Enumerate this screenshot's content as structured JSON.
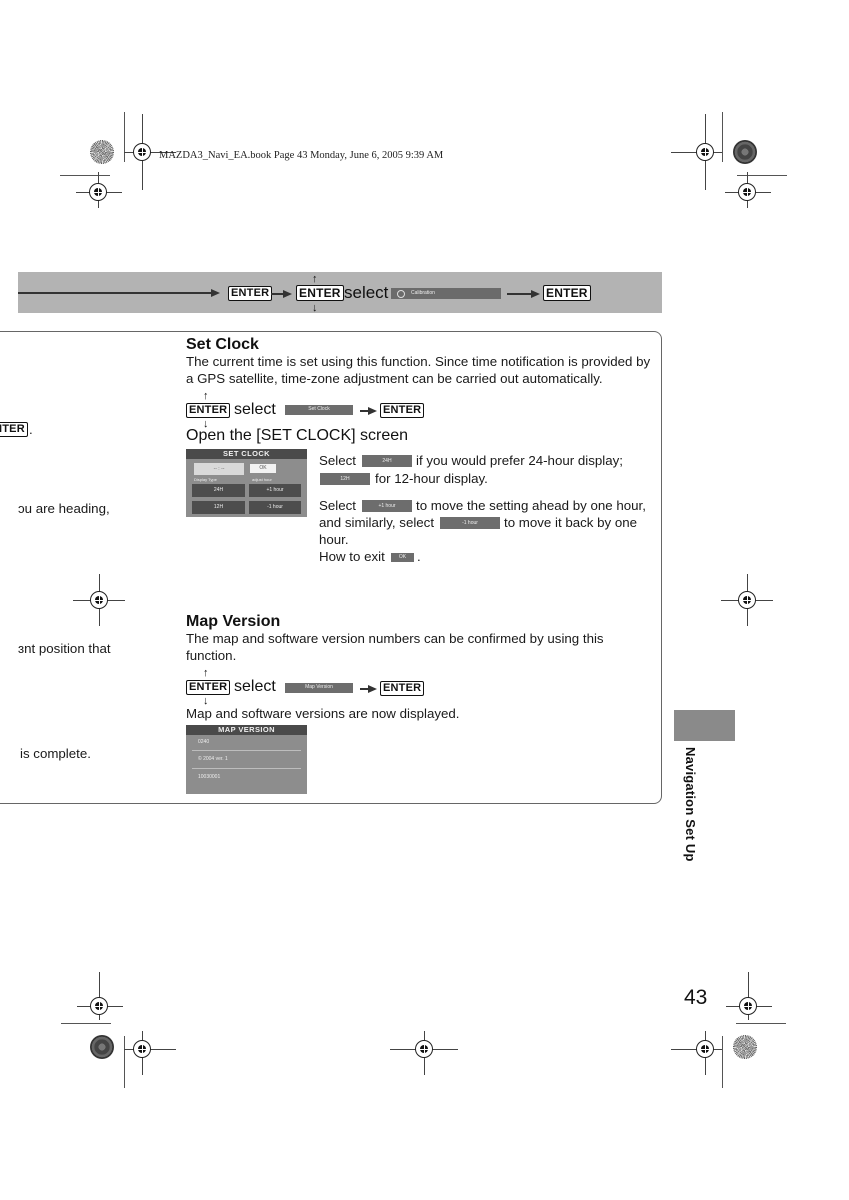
{
  "print_header": "MAZDA3_Navi_EA.book  Page 43  Monday, June 6, 2005  9:39 AM",
  "banner": {
    "enter_1": "ENTER",
    "enter_2": "ENTER",
    "select_word": "select",
    "menu_item": "Calibration",
    "enter_3": "ENTER"
  },
  "left_fragments": {
    "enter_partial": "ITER",
    "enter_period": ".",
    "line_1": "ɔu are heading,",
    "line_2": "ɜnt position that",
    "line_3": "is complete."
  },
  "set_clock": {
    "heading": "Set Clock",
    "description_line1": "The current time is set using this function. Since time notification is provided by",
    "description_line2": "a GPS satellite, time-zone adjustment can be carried out automatically.",
    "enter_1": "ENTER",
    "select_word": "select",
    "menu_item": "Set Clock",
    "enter_2": "ENTER",
    "open_screen": "Open the [SET CLOCK] screen",
    "screen": {
      "title": "SET CLOCK",
      "time_field": "-- : --",
      "ok": "OK",
      "display_type_label": "Display Type",
      "adjust_hour_label": "adjust hour",
      "btn_24h": "24H",
      "btn_12h": "12H",
      "btn_plus": "+1 hour",
      "btn_minus": "-1 hour"
    },
    "instr": {
      "select_1": "Select",
      "chip_24h": "24H",
      "text_24h": "if you would prefer 24-hour display;",
      "chip_12h": "12H",
      "text_12h": "for 12-hour display.",
      "select_2": "Select",
      "chip_plus": "+1 hour",
      "text_plus": "to move the setting ahead by one hour,",
      "text_similarly": "and similarly, select",
      "chip_minus": "-1 hour",
      "text_minus": "to move it back by one",
      "text_hour": "hour.",
      "text_exit": "How to exit",
      "chip_ok": "OK",
      "text_period": "."
    }
  },
  "map_version": {
    "heading": "Map Version",
    "description_line1": "The map and software version numbers can be confirmed by using this",
    "description_line2": "function.",
    "enter_1": "ENTER",
    "select_word": "select",
    "menu_item": "Map Version",
    "enter_2": "ENTER",
    "displayed_text": "Map and software versions are now displayed.",
    "screen": {
      "title": "MAP VERSION",
      "row_1": "0240",
      "row_2": "© 2004  ver. 1",
      "row_3": "10030001"
    }
  },
  "side_tab": {
    "label": "Navigation Set Up"
  },
  "page_number": "43"
}
